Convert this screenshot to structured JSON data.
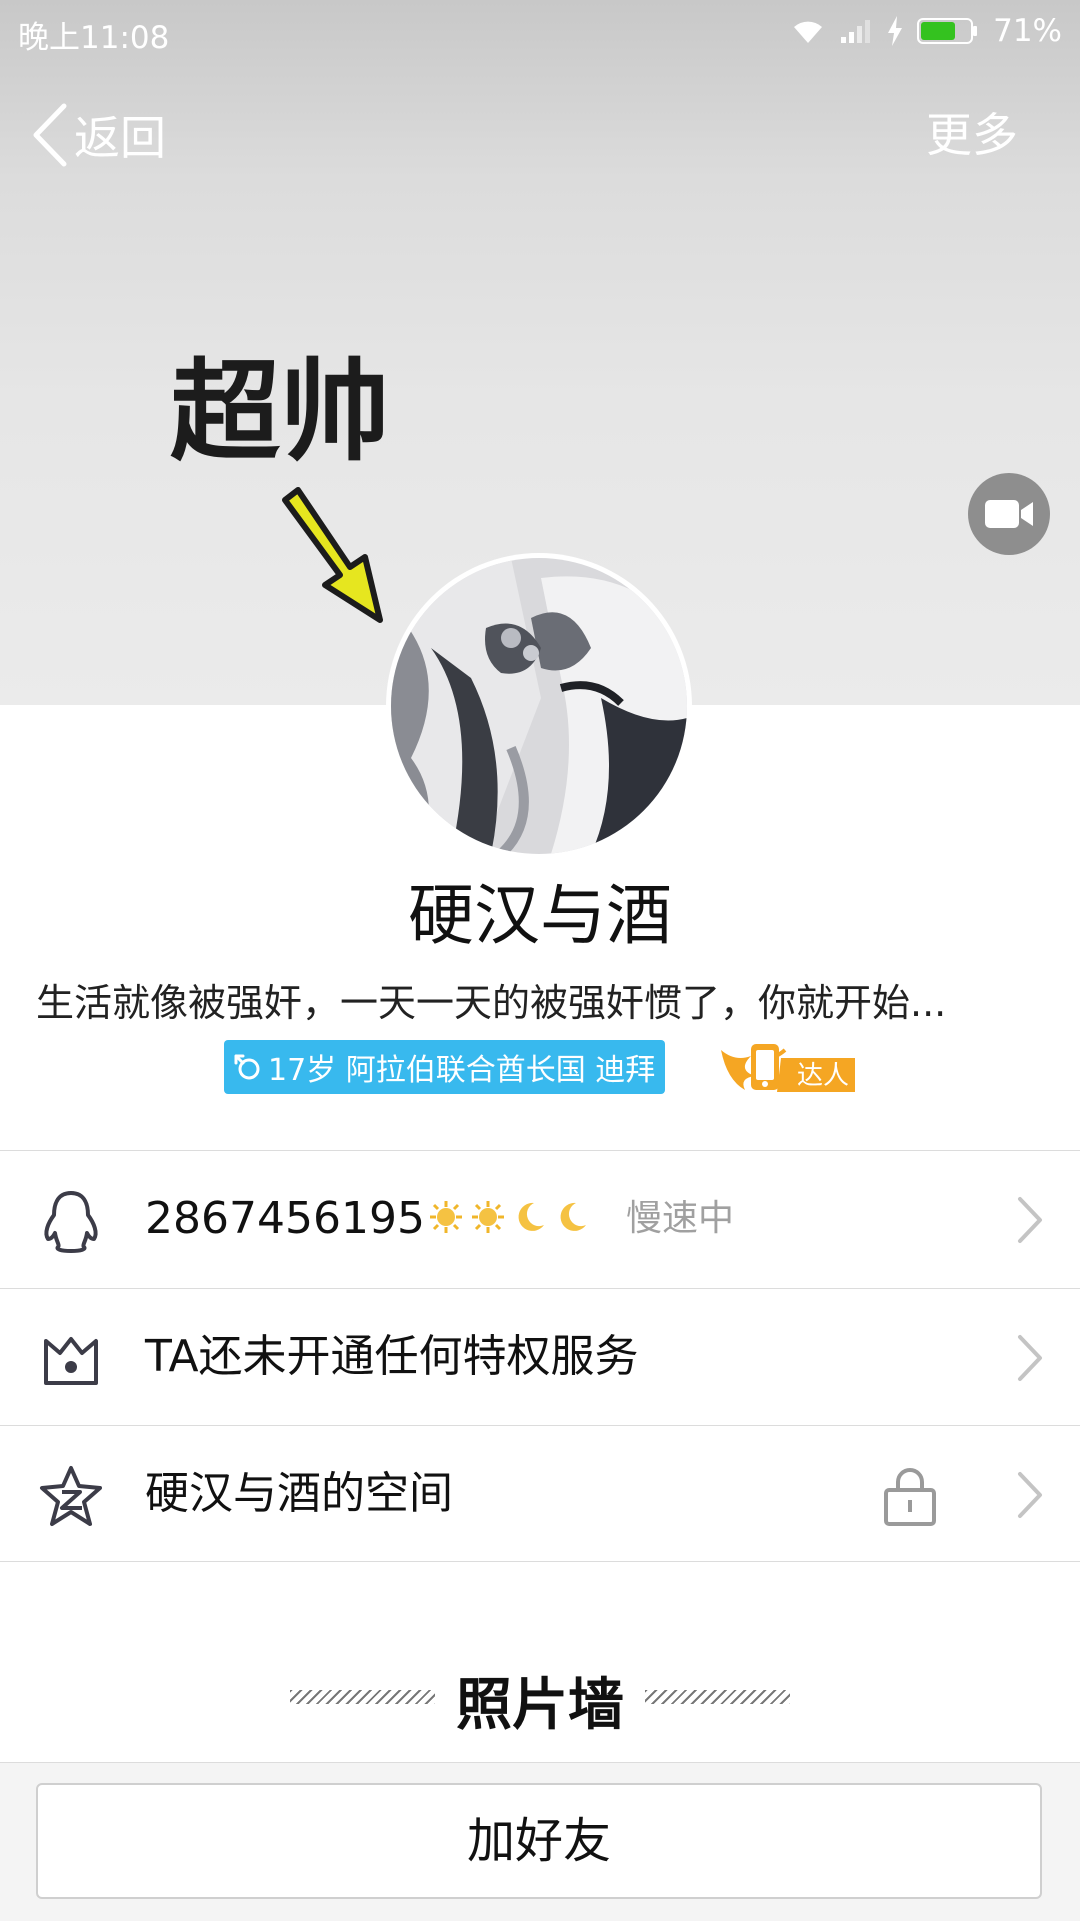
{
  "status_bar": {
    "time": "晚上11:08",
    "battery_percent": "71%",
    "battery_level": 0.71,
    "battery_color": "#34c21f"
  },
  "nav": {
    "back_label": "返回",
    "more_label": "更多"
  },
  "cover": {
    "doodle_text": "超帅",
    "arrow_color": "#e6e61f"
  },
  "profile": {
    "nickname": "硬汉与酒",
    "signature": "生活就像被强奸，一天一天的被强奸惯了，你就开始...",
    "info_tag": "17岁 阿拉伯联合酋长国 迪拜",
    "info_tag_color": "#38b9ee",
    "talent_badge": "达人",
    "talent_color": "#f5a623"
  },
  "list": {
    "qq_row": {
      "number": "2867456195",
      "level_icons": [
        "sun-icon",
        "sun-icon",
        "moon-icon",
        "moon-icon"
      ],
      "speed_status": "慢速中"
    },
    "privilege_row": {
      "label": "TA还未开通任何特权服务"
    },
    "space_row": {
      "label": "硬汉与酒的空间"
    }
  },
  "photo_wall": {
    "title": "照片墙"
  },
  "bottom": {
    "add_friend_label": "加好友"
  }
}
